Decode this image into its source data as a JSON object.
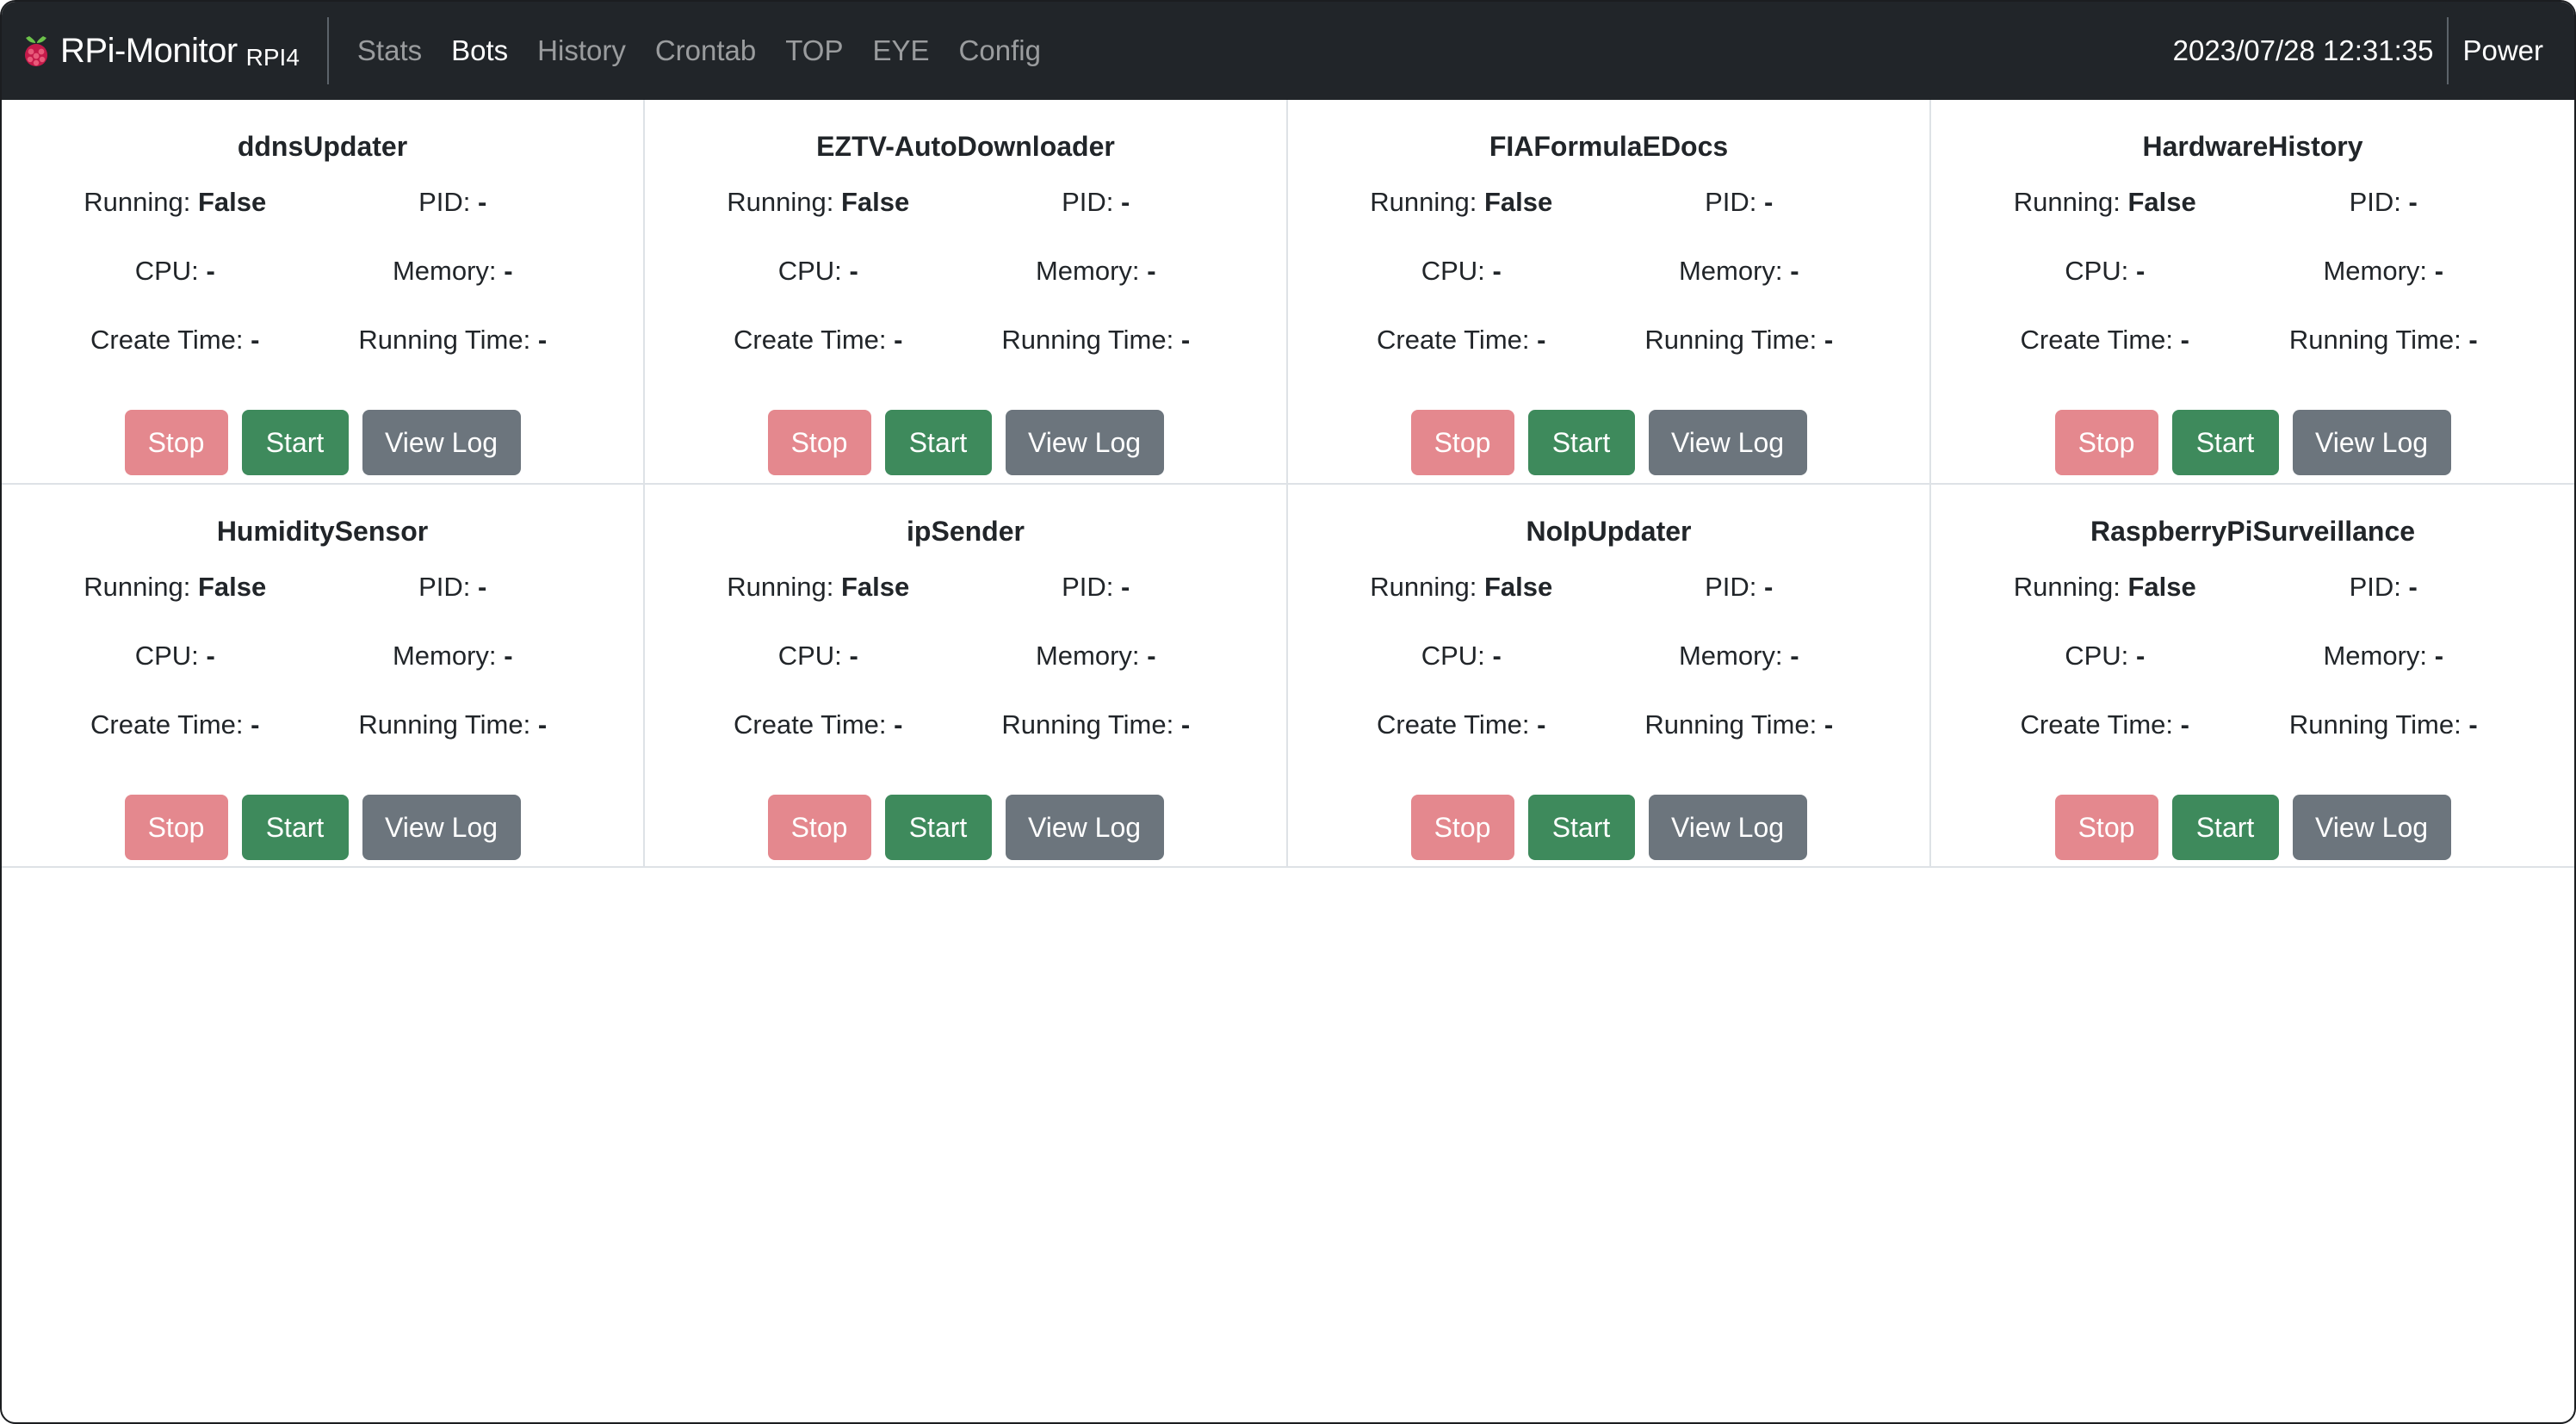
{
  "navbar": {
    "brand": "RPi-Monitor",
    "brand_sub": "RPI4",
    "links": [
      {
        "label": "Stats",
        "active": false
      },
      {
        "label": "Bots",
        "active": true
      },
      {
        "label": "History",
        "active": false
      },
      {
        "label": "Crontab",
        "active": false
      },
      {
        "label": "TOP",
        "active": false
      },
      {
        "label": "EYE",
        "active": false
      },
      {
        "label": "Config",
        "active": false
      }
    ],
    "datetime": "2023/07/28 12:31:35",
    "power_label": "Power"
  },
  "labels": {
    "running": "Running:",
    "pid": "PID:",
    "cpu": "CPU:",
    "memory": "Memory:",
    "create_time": "Create Time:",
    "running_time": "Running Time:",
    "stop": "Stop",
    "start": "Start",
    "view_log": "View Log"
  },
  "bots": [
    {
      "name": "ddnsUpdater",
      "running": "False",
      "pid": "-",
      "cpu": "-",
      "memory": "-",
      "create_time": "-",
      "running_time": "-"
    },
    {
      "name": "EZTV-AutoDownloader",
      "running": "False",
      "pid": "-",
      "cpu": "-",
      "memory": "-",
      "create_time": "-",
      "running_time": "-"
    },
    {
      "name": "FIAFormulaEDocs",
      "running": "False",
      "pid": "-",
      "cpu": "-",
      "memory": "-",
      "create_time": "-",
      "running_time": "-"
    },
    {
      "name": "HardwareHistory",
      "running": "False",
      "pid": "-",
      "cpu": "-",
      "memory": "-",
      "create_time": "-",
      "running_time": "-"
    },
    {
      "name": "HumiditySensor",
      "running": "False",
      "pid": "-",
      "cpu": "-",
      "memory": "-",
      "create_time": "-",
      "running_time": "-"
    },
    {
      "name": "ipSender",
      "running": "False",
      "pid": "-",
      "cpu": "-",
      "memory": "-",
      "create_time": "-",
      "running_time": "-"
    },
    {
      "name": "NoIpUpdater",
      "running": "False",
      "pid": "-",
      "cpu": "-",
      "memory": "-",
      "create_time": "-",
      "running_time": "-"
    },
    {
      "name": "RaspberryPiSurveillance",
      "running": "False",
      "pid": "-",
      "cpu": "-",
      "memory": "-",
      "create_time": "-",
      "running_time": "-"
    }
  ],
  "colors": {
    "navbar": "#212529",
    "stop": "#e4888e",
    "start": "#3e8a5c",
    "view_log": "#6c757d"
  }
}
